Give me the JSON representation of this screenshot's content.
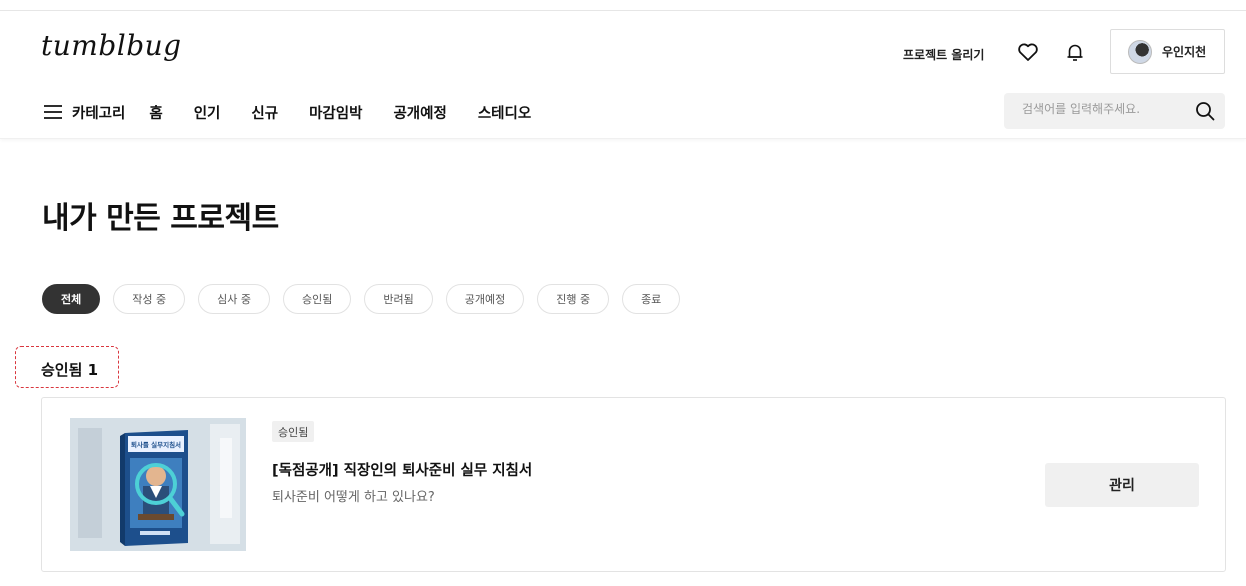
{
  "header": {
    "logo": "tumblbug",
    "upload_label": "프로젝트 올리기",
    "profile_name": "우인지천",
    "search_placeholder": "검색어를 입력해주세요."
  },
  "nav": {
    "category_label": "카테고리",
    "items": [
      "홈",
      "인기",
      "신규",
      "마감임박",
      "공개예정",
      "스테디오"
    ]
  },
  "page": {
    "title": "내가 만든 프로젝트"
  },
  "filters": [
    "전체",
    "작성 중",
    "심사 중",
    "승인됨",
    "반려됨",
    "공개예정",
    "진행 중",
    "종료"
  ],
  "active_filter": "전체",
  "section": {
    "label": "승인됨 1"
  },
  "project": {
    "status_badge": "승인됨",
    "title": "[독점공개] 직장인의 퇴사준비 실무 지침서",
    "subtitle": "퇴사준비 어떻게 하고 있나요?",
    "manage_label": "관리",
    "thumb_book_title": "퇴사를 실무지침서"
  },
  "icons": {
    "menu": "hamburger-menu-icon",
    "heart": "heart-icon",
    "bell": "bell-icon",
    "search": "search-icon"
  }
}
